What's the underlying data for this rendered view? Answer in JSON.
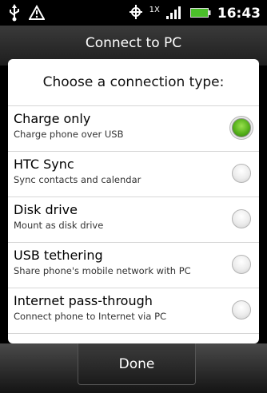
{
  "status_bar": {
    "time": "16:43",
    "network_type": "1X",
    "icons": [
      "usb-icon",
      "warning-icon",
      "gps-icon",
      "signal-icon",
      "battery-icon"
    ]
  },
  "header": {
    "title": "Connect to PC"
  },
  "dialog": {
    "title": "Choose a connection type:",
    "options": [
      {
        "label": "Charge only",
        "description": "Charge phone over USB",
        "selected": true
      },
      {
        "label": "HTC Sync",
        "description": "Sync contacts and calendar",
        "selected": false
      },
      {
        "label": "Disk drive",
        "description": "Mount as disk drive",
        "selected": false
      },
      {
        "label": "USB tethering",
        "description": "Share phone's mobile network with PC",
        "selected": false
      },
      {
        "label": "Internet pass-through",
        "description": "Connect phone to Internet via PC",
        "selected": false
      }
    ]
  },
  "footer": {
    "done_label": "Done"
  },
  "colors": {
    "accent": "#56b11b",
    "background": "#000000",
    "dialog": "#ffffff"
  }
}
